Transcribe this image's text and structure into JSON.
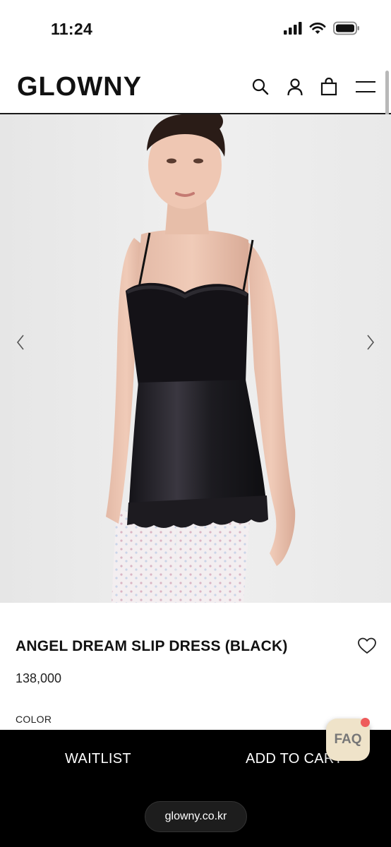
{
  "status_bar": {
    "time": "11:24",
    "icons": [
      "signal-icon",
      "wifi-icon",
      "battery-icon"
    ]
  },
  "header": {
    "logo": "GLOWNY",
    "icons": [
      "search-icon",
      "user-icon",
      "bag-icon",
      "menu-icon"
    ]
  },
  "gallery": {
    "prev_icon": "chevron-left-icon",
    "next_icon": "chevron-right-icon"
  },
  "product": {
    "name": "ANGEL DREAM SLIP DRESS (BLACK)",
    "price": "138,000",
    "color_label": "COLOR",
    "wishlist_icon": "heart-icon"
  },
  "actions": {
    "waitlist_label": "WAITLIST",
    "add_to_cart_label": "ADD TO CART"
  },
  "faq": {
    "label": "FAQ"
  },
  "browser": {
    "url": "glowny.co.kr"
  },
  "colors": {
    "action_bar": "#000000",
    "faq_bg": "#efe3c9",
    "faq_dot": "#ee5b5b",
    "hero_bg": "#ebebeb"
  }
}
